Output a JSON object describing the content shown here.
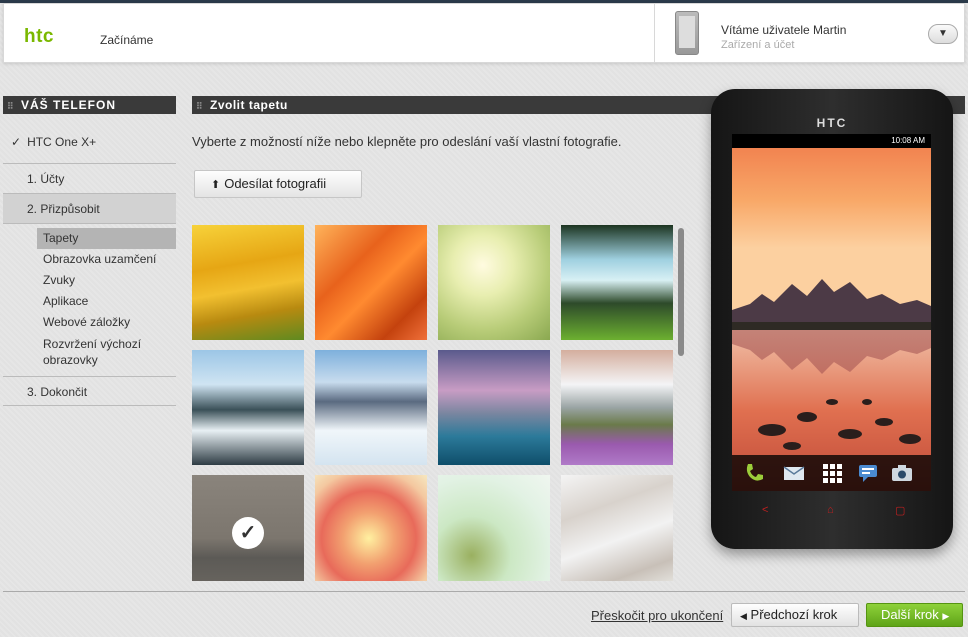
{
  "header": {
    "logo": "htc",
    "title": "Začínáme",
    "user_greeting": "Vítáme uživatele Martin",
    "user_subtitle": "Zařízení a účet",
    "dropdown_icon": "chevron-down-icon"
  },
  "sidebar": {
    "heading": "VÁŠ TELEFON",
    "device": "HTC One X+",
    "steps": [
      "1. Účty",
      "2. Přizpůsobit",
      "3. Dokončit"
    ],
    "sub_items": [
      "Tapety",
      "Obrazovka uzamčení",
      "Zvuky",
      "Aplikace",
      "Webové záložky",
      "Rozvržení výchozí obrazovky"
    ]
  },
  "content": {
    "heading": "Zvolit tapetu",
    "description": "Vyberte z možností níže nebo klepněte pro odeslání vaší vlastní fotografie.",
    "upload_label": "Odesílat fotografii",
    "wallpapers": [
      "yellow-dunes",
      "orange-canyon",
      "dandelion",
      "waterfall",
      "seashore",
      "snowy-forest",
      "mountain-lake",
      "lavender-mountain",
      "selected-dark",
      "rose",
      "mint-bird",
      "snowy-branches"
    ],
    "selected_index": 8
  },
  "phone": {
    "brand": "HTC",
    "time": "10:08 AM"
  },
  "footer": {
    "skip": "Přeskočit pro ukončení",
    "prev": "Předchozí krok",
    "next": "Další krok"
  },
  "colors": {
    "accent_green": "#7ab800",
    "next_button": "#6db323",
    "section_bar": "#3a3a3a"
  }
}
